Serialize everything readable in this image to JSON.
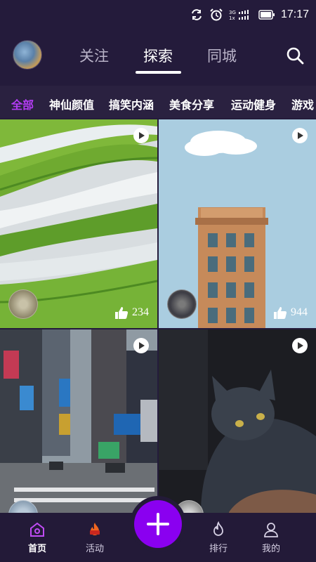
{
  "status_bar": {
    "time": "17:17",
    "network": "3G 1x"
  },
  "header": {
    "tabs": [
      {
        "label": "关注",
        "active": false
      },
      {
        "label": "探索",
        "active": true
      },
      {
        "label": "同城",
        "active": false
      }
    ]
  },
  "categories": [
    {
      "label": "全部",
      "active": true
    },
    {
      "label": "神仙颜值",
      "active": false
    },
    {
      "label": "搞笑内涵",
      "active": false
    },
    {
      "label": "美食分享",
      "active": false
    },
    {
      "label": "运动健身",
      "active": false
    },
    {
      "label": "游戏",
      "active": false
    }
  ],
  "feed": [
    {
      "name": "rice-terraces",
      "likes": "234",
      "video": true
    },
    {
      "name": "tower-building",
      "likes": "944",
      "video": true
    },
    {
      "name": "city-street",
      "likes": "",
      "video": true
    },
    {
      "name": "black-cat",
      "likes": "",
      "video": true
    }
  ],
  "bottom_nav": [
    {
      "label": "首页",
      "icon": "home-icon",
      "active": true
    },
    {
      "label": "活动",
      "icon": "hot-flame-icon",
      "active": false
    },
    {
      "label": "",
      "icon": "plus-icon",
      "active": false
    },
    {
      "label": "排行",
      "icon": "flame-icon",
      "active": false
    },
    {
      "label": "我的",
      "icon": "user-icon",
      "active": false
    }
  ],
  "colors": {
    "background": "#241b3b",
    "accent": "#8a00f0",
    "active_category": "#b43cf5"
  }
}
